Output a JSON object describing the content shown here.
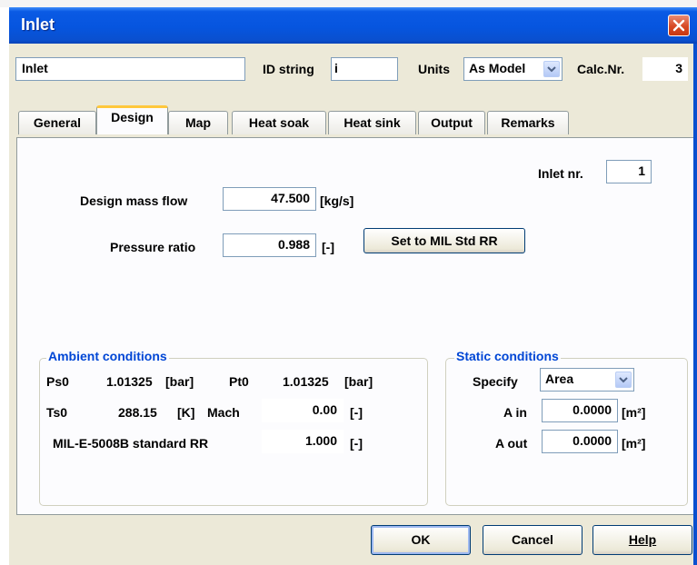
{
  "window": {
    "title": "Inlet"
  },
  "header": {
    "name_value": "Inlet",
    "id_label": "ID string",
    "id_value": "i",
    "units_label": "Units",
    "units_value": "As Model",
    "calc_label": "Calc.Nr.",
    "calc_value": "3"
  },
  "tabs": [
    {
      "label": "General"
    },
    {
      "label": "Design",
      "active": true
    },
    {
      "label": "Map"
    },
    {
      "label": "Heat soak"
    },
    {
      "label": "Heat sink"
    },
    {
      "label": "Output"
    },
    {
      "label": "Remarks"
    }
  ],
  "design": {
    "inlet_nr_label": "Inlet nr.",
    "inlet_nr_value": "1",
    "mass_flow_label": "Design mass flow",
    "mass_flow_value": "47.500",
    "mass_flow_unit": "[kg/s]",
    "pressure_ratio_label": "Pressure ratio",
    "pressure_ratio_value": "0.988",
    "pressure_ratio_unit": "[-]",
    "set_mil_button": "Set to MIL Std RR"
  },
  "ambient": {
    "title": "Ambient conditions",
    "ps0_label": "Ps0",
    "ps0_value": "1.01325",
    "ps0_unit": "[bar]",
    "pt0_label": "Pt0",
    "pt0_value": "1.01325",
    "pt0_unit": "[bar]",
    "ts0_label": "Ts0",
    "ts0_value": "288.15",
    "ts0_unit": "[K]",
    "mach_label": "Mach",
    "mach_value": "0.00",
    "mach_unit": "[-]",
    "mil_label": "MIL-E-5008B standard RR",
    "mil_value": "1.000",
    "mil_unit": "[-]"
  },
  "static": {
    "title": "Static conditions",
    "specify_label": "Specify",
    "specify_value": "Area",
    "ain_label": "A in",
    "ain_value": "0.0000",
    "ain_unit": "[m²]",
    "aout_label": "A out",
    "aout_value": "0.0000",
    "aout_unit": "[m²]"
  },
  "footer": {
    "ok": "OK",
    "cancel": "Cancel",
    "help": "Help"
  },
  "colors": {
    "title_blue": "#0655df",
    "legend_blue": "#0046d5",
    "close_red": "#d74a26",
    "tab_highlight": "#ffc83c"
  },
  "icons": {
    "close": "close-icon",
    "dropdown": "chevron-down-icon"
  }
}
